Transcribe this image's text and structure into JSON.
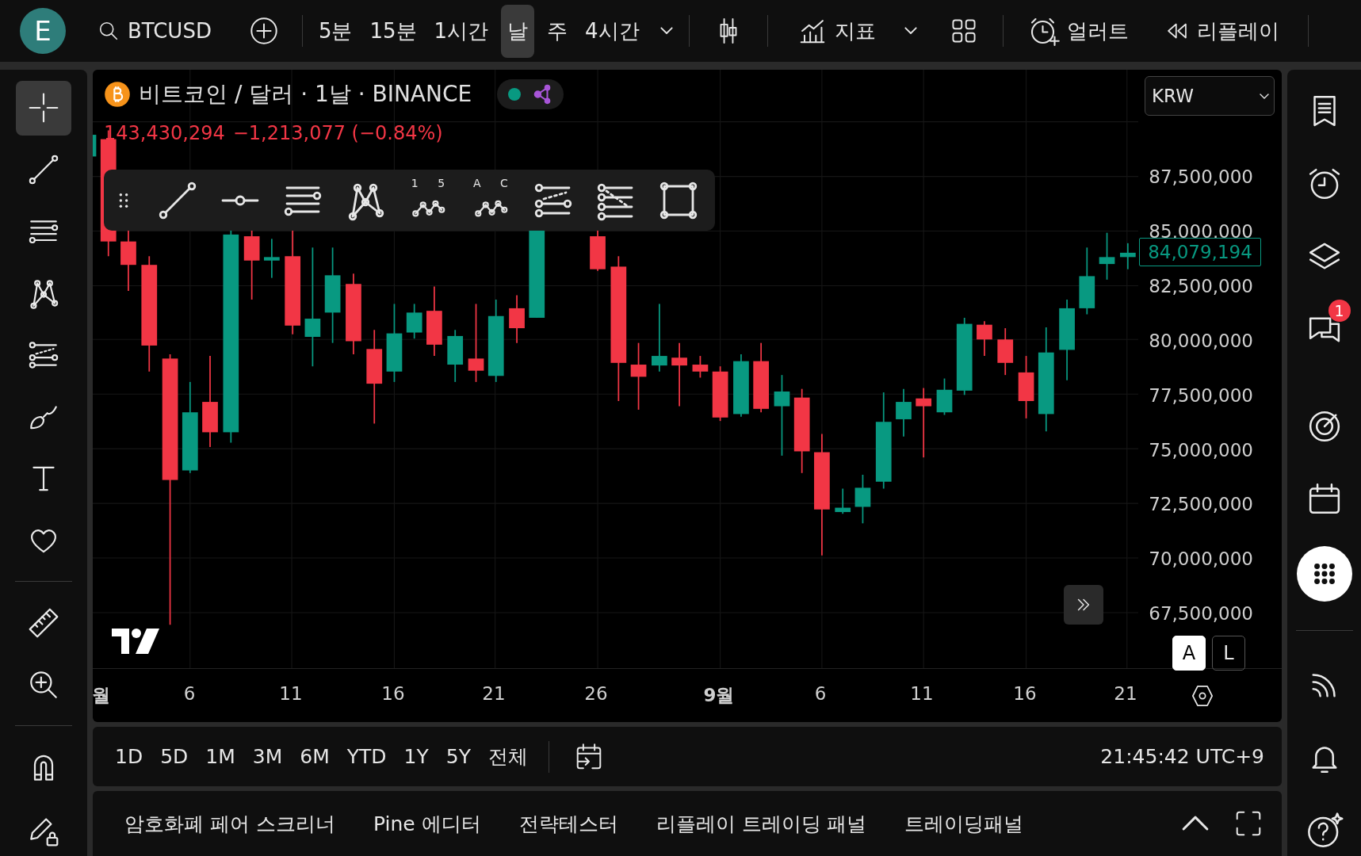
{
  "top_bar": {
    "avatar": "E",
    "symbol": "BTCUSD",
    "intervals": [
      {
        "label": "5분",
        "selected": false
      },
      {
        "label": "15분",
        "selected": false
      },
      {
        "label": "1시간",
        "selected": false
      },
      {
        "label": "날",
        "selected": true
      },
      {
        "label": "주",
        "selected": false
      },
      {
        "label": "4시간",
        "selected": false
      }
    ],
    "indicators": "지표",
    "alert": "얼러트",
    "replay": "리플레이"
  },
  "left_toolbar": [
    {
      "kind": "crosshair",
      "selected": true
    },
    {
      "kind": "trend-line",
      "selected": false
    },
    {
      "kind": "parallel",
      "selected": false
    },
    {
      "kind": "pattern",
      "selected": false
    },
    {
      "kind": "fib",
      "selected": false
    },
    {
      "kind": "brush",
      "selected": false
    },
    {
      "kind": "text",
      "selected": false
    },
    {
      "kind": "heart",
      "selected": false
    },
    {
      "kind": "divider"
    },
    {
      "kind": "ruler",
      "selected": false
    },
    {
      "kind": "zoom",
      "selected": false
    },
    {
      "kind": "divider"
    },
    {
      "kind": "magnet",
      "selected": false
    },
    {
      "kind": "pencil-lock",
      "selected": false
    }
  ],
  "chart": {
    "title": "비트코인 / 달러 · 1날 · BINANCE",
    "price": "143,430,294",
    "change": "−1,213,077 (−0.84%)",
    "currency": "KRW",
    "price_ticks": [
      "87,500,000",
      "85,000,000",
      "82,500,000",
      "80,000,000",
      "77,500,000",
      "75,000,000",
      "72,500,000",
      "70,000,000",
      "67,500,000"
    ],
    "last_price": "84,079,194",
    "time_ticks": [
      {
        "label": "월",
        "major": true
      },
      {
        "label": "6",
        "major": false
      },
      {
        "label": "11",
        "major": false
      },
      {
        "label": "16",
        "major": false
      },
      {
        "label": "21",
        "major": false
      },
      {
        "label": "26",
        "major": false
      },
      {
        "label": "9월",
        "major": true
      },
      {
        "label": "6",
        "major": false
      },
      {
        "label": "11",
        "major": false
      },
      {
        "label": "16",
        "major": false
      },
      {
        "label": "21",
        "major": false
      }
    ],
    "scale_buttons": [
      {
        "label": "A",
        "selected": true
      },
      {
        "label": "L",
        "selected": false
      }
    ],
    "drawing_tools": [
      {
        "kind": "handle"
      },
      {
        "kind": "line"
      },
      {
        "kind": "ray"
      },
      {
        "kind": "parallel"
      },
      {
        "kind": "pattern"
      },
      {
        "kind": "wave",
        "label": "1 5"
      },
      {
        "kind": "wave",
        "label": "A C"
      },
      {
        "kind": "fib"
      },
      {
        "kind": "fib-fan"
      },
      {
        "kind": "rectangle"
      }
    ]
  },
  "range_bar": {
    "ranges": [
      "1D",
      "5D",
      "1M",
      "3M",
      "6M",
      "YTD",
      "1Y",
      "5Y",
      "전체"
    ],
    "clock": "21:45:42 UTC+9"
  },
  "bottom_tabs": [
    "암호화폐 페어 스크리너",
    "Pine 에디터",
    "전략테스터",
    "리플레이 트레이딩 패널",
    "트레이딩패널"
  ],
  "right_toolbar": [
    {
      "kind": "watchlist",
      "selected": false
    },
    {
      "kind": "alarm",
      "selected": false
    },
    {
      "kind": "layers",
      "selected": false
    },
    {
      "kind": "chat",
      "selected": false,
      "badge": "1"
    },
    {
      "kind": "gap"
    },
    {
      "kind": "target",
      "selected": false
    },
    {
      "kind": "calendar",
      "selected": false
    },
    {
      "kind": "apps",
      "selected": true
    },
    {
      "kind": "divider"
    },
    {
      "kind": "broadcast",
      "selected": false
    },
    {
      "kind": "bell",
      "selected": false
    },
    {
      "kind": "help",
      "selected": false
    }
  ]
}
